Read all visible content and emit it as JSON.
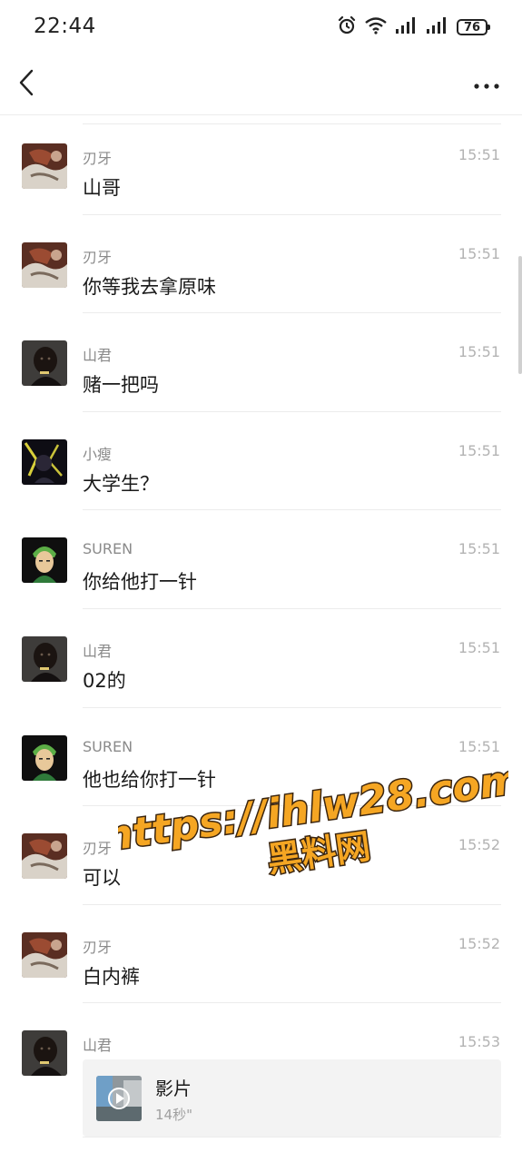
{
  "status_bar": {
    "time": "22:44",
    "battery": "76",
    "icons": [
      "alarm-icon",
      "wifi-icon",
      "signal-icon",
      "signal-icon"
    ]
  },
  "nav": {
    "back_icon": "chevron-left-icon",
    "more_icon": "more-dots-icon"
  },
  "messages": [
    {
      "name": "刃牙",
      "time": "15:51",
      "text": "山哥",
      "avatar": "renya"
    },
    {
      "name": "刃牙",
      "time": "15:51",
      "text": "你等我去拿原味",
      "avatar": "renya"
    },
    {
      "name": "山君",
      "time": "15:51",
      "text": "赌一把吗",
      "avatar": "shanjun"
    },
    {
      "name": "小瘦",
      "time": "15:51",
      "text": "大学生？",
      "avatar": "xiaoshou"
    },
    {
      "name": "SUREN",
      "time": "15:51",
      "text": "你给他打一针",
      "avatar": "suren"
    },
    {
      "name": "山君",
      "time": "15:51",
      "text": "02的",
      "avatar": "shanjun"
    },
    {
      "name": "SUREN",
      "time": "15:51",
      "text": "他也给你打一针",
      "avatar": "suren"
    },
    {
      "name": "刃牙",
      "time": "15:52",
      "text": "可以",
      "avatar": "renya"
    },
    {
      "name": "刃牙",
      "time": "15:52",
      "text": "白内裤",
      "avatar": "renya"
    }
  ],
  "video_message": {
    "name": "山君",
    "time": "15:53",
    "title": "影片",
    "duration": "14秒\"",
    "avatar": "shanjun"
  },
  "watermark": {
    "line1": "https://ihlw28.com",
    "line2": "黑料网"
  },
  "colors": {
    "watermark_fill": "#f5a623",
    "watermark_stroke": "#3a2510",
    "separator": "#ececec"
  }
}
